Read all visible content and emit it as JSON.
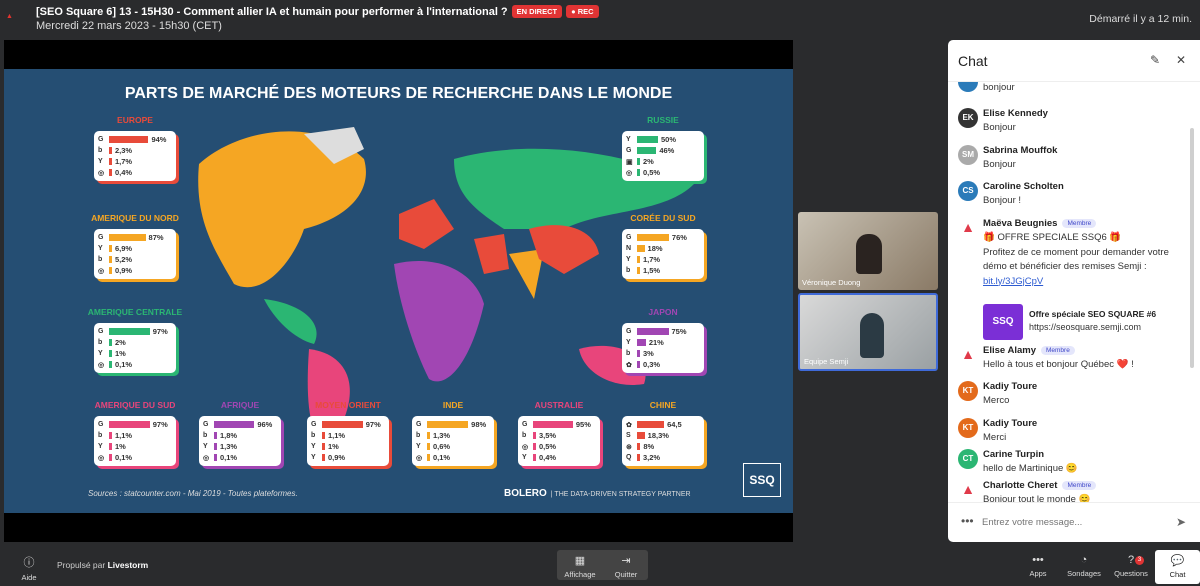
{
  "header": {
    "title": "[SEO Square 6] 13 - 15H30 - Comment allier IA et humain pour performer à l'international ?",
    "badge_live": "EN DIRECT",
    "badge_rec": "● REC",
    "date": "Mercredi 22 mars 2023 - 15h30 (CET)",
    "started": "Démarré il y a 12 min."
  },
  "slide": {
    "title": "PARTS DE MARCHÉ DES MOTEURS DE RECHERCHE DANS LE MONDE",
    "source": "Sources : statcounter.com - Mai 2019 - Toutes plateformes.",
    "brand": "BOLERO",
    "brand_tag": "| THE DATA-DRIVEN STRATEGY PARTNER",
    "ssq": "SSQ",
    "regions": [
      {
        "name": "EUROPE",
        "color": "#e84b3a",
        "rows": [
          {
            "i": "G",
            "v": "94%",
            "p": 0.94,
            "c": "#e84b3a"
          },
          {
            "i": "b",
            "v": "2,3%",
            "p": 0.023,
            "c": "#e84b3a"
          },
          {
            "i": "Y",
            "v": "1,7%",
            "p": 0.017,
            "c": "#e84b3a"
          },
          {
            "i": "◎",
            "v": "0,4%",
            "p": 0.004,
            "c": "#e84b3a"
          }
        ]
      },
      {
        "name": "AMERIQUE DU NORD",
        "color": "#f5a623",
        "rows": [
          {
            "i": "G",
            "v": "87%",
            "p": 0.87,
            "c": "#f5a623"
          },
          {
            "i": "Y",
            "v": "6,9%",
            "p": 0.069,
            "c": "#f5a623"
          },
          {
            "i": "b",
            "v": "5,2%",
            "p": 0.052,
            "c": "#f5a623"
          },
          {
            "i": "◎",
            "v": "0,9%",
            "p": 0.009,
            "c": "#f5a623"
          }
        ]
      },
      {
        "name": "AMERIQUE CENTRALE",
        "color": "#2bb673",
        "rows": [
          {
            "i": "G",
            "v": "97%",
            "p": 0.97,
            "c": "#2bb673"
          },
          {
            "i": "b",
            "v": "2%",
            "p": 0.02,
            "c": "#2bb673"
          },
          {
            "i": "Y",
            "v": "1%",
            "p": 0.01,
            "c": "#2bb673"
          },
          {
            "i": "◎",
            "v": "0,1%",
            "p": 0.001,
            "c": "#2bb673"
          }
        ]
      },
      {
        "name": "AMERIQUE DU SUD",
        "color": "#e8457b",
        "rows": [
          {
            "i": "G",
            "v": "97%",
            "p": 0.97,
            "c": "#e8457b"
          },
          {
            "i": "b",
            "v": "1,1%",
            "p": 0.011,
            "c": "#e8457b"
          },
          {
            "i": "Y",
            "v": "1%",
            "p": 0.01,
            "c": "#e8457b"
          },
          {
            "i": "◎",
            "v": "0,1%",
            "p": 0.001,
            "c": "#e8457b"
          }
        ]
      },
      {
        "name": "AFRIQUE",
        "color": "#a146b3",
        "rows": [
          {
            "i": "G",
            "v": "96%",
            "p": 0.96,
            "c": "#a146b3"
          },
          {
            "i": "b",
            "v": "1,8%",
            "p": 0.018,
            "c": "#a146b3"
          },
          {
            "i": "Y",
            "v": "1,3%",
            "p": 0.013,
            "c": "#a146b3"
          },
          {
            "i": "◎",
            "v": "0,1%",
            "p": 0.001,
            "c": "#a146b3"
          }
        ]
      },
      {
        "name": "MOYEN ORIENT",
        "color": "#e84b3a",
        "rows": [
          {
            "i": "G",
            "v": "97%",
            "p": 0.97,
            "c": "#e84b3a"
          },
          {
            "i": "b",
            "v": "1,1%",
            "p": 0.011,
            "c": "#e84b3a"
          },
          {
            "i": "Y",
            "v": "1%",
            "p": 0.01,
            "c": "#e84b3a"
          },
          {
            "i": "Y",
            "v": "0,9%",
            "p": 0.009,
            "c": "#e84b3a"
          }
        ]
      },
      {
        "name": "INDE",
        "color": "#f5a623",
        "rows": [
          {
            "i": "G",
            "v": "98%",
            "p": 0.98,
            "c": "#f5a623"
          },
          {
            "i": "b",
            "v": "1,3%",
            "p": 0.013,
            "c": "#f5a623"
          },
          {
            "i": "Y",
            "v": "0,6%",
            "p": 0.006,
            "c": "#f5a623"
          },
          {
            "i": "◎",
            "v": "0,1%",
            "p": 0.001,
            "c": "#f5a623"
          }
        ]
      },
      {
        "name": "AUSTRALIE",
        "color": "#e8457b",
        "rows": [
          {
            "i": "G",
            "v": "95%",
            "p": 0.95,
            "c": "#e8457b"
          },
          {
            "i": "b",
            "v": "3,5%",
            "p": 0.035,
            "c": "#e8457b"
          },
          {
            "i": "◎",
            "v": "0,5%",
            "p": 0.005,
            "c": "#e8457b"
          },
          {
            "i": "Y",
            "v": "0,4%",
            "p": 0.004,
            "c": "#e8457b"
          }
        ]
      },
      {
        "name": "RUSSIE",
        "color": "#2bb673",
        "rows": [
          {
            "i": "Y",
            "v": "50%",
            "p": 0.5,
            "c": "#2bb673"
          },
          {
            "i": "G",
            "v": "46%",
            "p": 0.46,
            "c": "#2bb673"
          },
          {
            "i": "▣",
            "v": "2%",
            "p": 0.02,
            "c": "#2bb673"
          },
          {
            "i": "◎",
            "v": "0,5%",
            "p": 0.005,
            "c": "#2bb673"
          }
        ]
      },
      {
        "name": "CORÉE DU SUD",
        "color": "#f5a623",
        "rows": [
          {
            "i": "G",
            "v": "76%",
            "p": 0.76,
            "c": "#f5a623"
          },
          {
            "i": "N",
            "v": "18%",
            "p": 0.18,
            "c": "#f5a623"
          },
          {
            "i": "Y",
            "v": "1,7%",
            "p": 0.017,
            "c": "#f5a623"
          },
          {
            "i": "b",
            "v": "1,5%",
            "p": 0.015,
            "c": "#f5a623"
          }
        ]
      },
      {
        "name": "JAPON",
        "color": "#a146b3",
        "rows": [
          {
            "i": "G",
            "v": "75%",
            "p": 0.75,
            "c": "#a146b3"
          },
          {
            "i": "Y",
            "v": "21%",
            "p": 0.21,
            "c": "#a146b3"
          },
          {
            "i": "b",
            "v": "3%",
            "p": 0.03,
            "c": "#a146b3"
          },
          {
            "i": "✿",
            "v": "0,3%",
            "p": 0.003,
            "c": "#a146b3"
          }
        ]
      },
      {
        "name": "CHINE",
        "color": "#f5a623",
        "rows": [
          {
            "i": "✿",
            "v": "64,5",
            "p": 0.645,
            "c": "#e84b3a"
          },
          {
            "i": "S",
            "v": "18,3%",
            "p": 0.183,
            "c": "#e84b3a"
          },
          {
            "i": "⊛",
            "v": "8%",
            "p": 0.08,
            "c": "#e84b3a"
          },
          {
            "i": "Q",
            "v": "3,2%",
            "p": 0.032,
            "c": "#e84b3a"
          }
        ]
      }
    ]
  },
  "videos": [
    {
      "name": "Véronique Duong"
    },
    {
      "name": "Equipe Semji"
    }
  ],
  "chat": {
    "title": "Chat",
    "placeholder": "Entrez votre message...",
    "messages": [
      {
        "initials": "",
        "name": "",
        "text": "bonjour",
        "color": "#2b7bb9"
      },
      {
        "initials": "EK",
        "name": "Elise Kennedy",
        "text": "Bonjour",
        "color": "#333"
      },
      {
        "initials": "SM",
        "name": "Sabrina Mouffok",
        "text": "Bonjour",
        "color": "#aaa"
      },
      {
        "initials": "CS",
        "name": "Caroline Scholten",
        "text": "Bonjour !",
        "color": "#2b7bb9"
      },
      {
        "initials": "",
        "name": "Maëva Beugnies",
        "member": "Membre",
        "text": "🎁 OFFRE SPECIALE SSQ6 🎁",
        "text2": "Profitez de ce moment pour demander votre démo et bénéficier des remises Semji :",
        "link": "bit.ly/3JGjCpV",
        "offer_title": "Offre spéciale SEO SQUARE #6",
        "offer_url": "https://seosquare.semji.com",
        "color": "#e03a4a"
      },
      {
        "initials": "",
        "name": "Elise Alamy",
        "member": "Membre",
        "text": "Hello à tous et bonjour Québec ❤️ !",
        "color": "#e03a4a"
      },
      {
        "initials": "KT",
        "name": "Kadiy Toure",
        "text": "Merco",
        "color": "#e36a1b"
      },
      {
        "initials": "KT",
        "name": "Kadiy Toure",
        "text": "Merci",
        "color": "#e36a1b"
      },
      {
        "initials": "CT",
        "name": "Carine Turpin",
        "text": "hello de Martinique 😊",
        "color": "#2bb673"
      },
      {
        "initials": "",
        "name": "Charlotte Cheret",
        "member": "Membre",
        "text": "Bonjour tout le monde 😊",
        "color": "#e03a4a"
      }
    ]
  },
  "bottom": {
    "help": "Aide",
    "powered": "Propulsé par",
    "powered_brand": "Livestorm",
    "display": "Affichage",
    "quit": "Quitter",
    "apps": "Apps",
    "polls": "Sondages",
    "questions": "Questions",
    "questions_count": "3",
    "chat": "Chat"
  }
}
